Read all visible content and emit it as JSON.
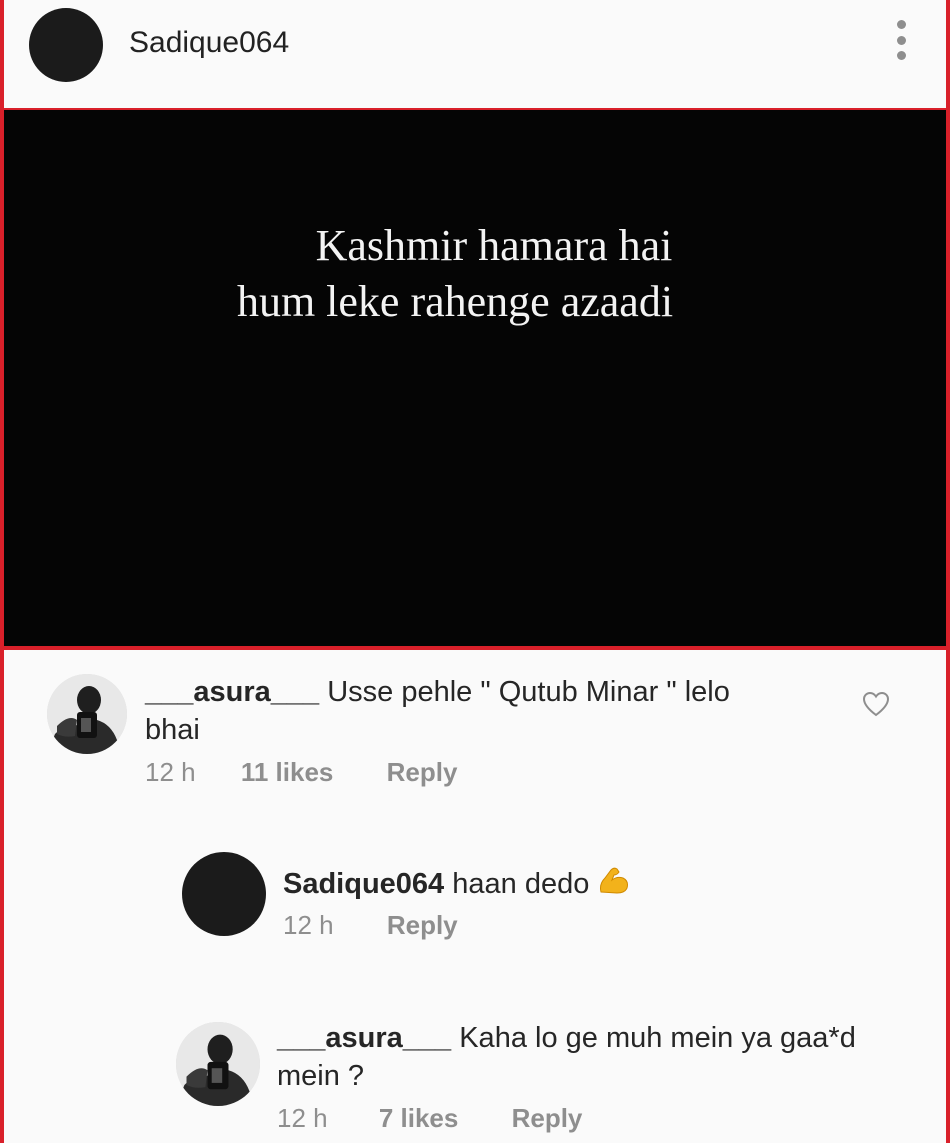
{
  "post": {
    "username": "Sadique064",
    "caption_line1": "Kashmir hamara hai",
    "caption_line2": "hum leke rahenge azaadi",
    "more_icon": "more-vertical-icon"
  },
  "comments": [
    {
      "username": "___asura___",
      "text": "Usse pehle \" Qutub Minar  \" lelo",
      "text_cont": "bhai",
      "time": "12 h",
      "likes": "11 likes",
      "reply": "Reply",
      "like_icon": "heart-outline-icon"
    },
    {
      "username": "Sadique064",
      "text": "haan dedo",
      "emoji": "flexed-biceps-icon",
      "time": "12 h",
      "reply": "Reply"
    },
    {
      "username": "___asura___",
      "text": "Kaha lo ge muh mein ya gaa*d",
      "text_cont": "mein ?",
      "time": "12 h",
      "likes": "7 likes",
      "reply": "Reply"
    }
  ],
  "colors": {
    "frame_red": "#d9202a",
    "muted": "#8e8e8e",
    "background": "#fafafa"
  }
}
